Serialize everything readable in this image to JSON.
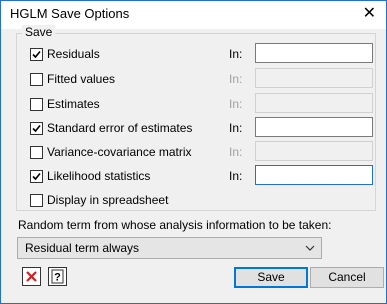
{
  "window": {
    "title": "HGLM Save Options"
  },
  "save_group": {
    "label": "Save",
    "in_label": "In:",
    "options": [
      {
        "label": "Residuals",
        "checked": true,
        "in_enabled": true,
        "focused": false
      },
      {
        "label": "Fitted values",
        "checked": false,
        "in_enabled": false,
        "focused": false
      },
      {
        "label": "Estimates",
        "checked": false,
        "in_enabled": false,
        "focused": false
      },
      {
        "label": "Standard error of estimates",
        "checked": true,
        "in_enabled": true,
        "focused": false
      },
      {
        "label": "Variance-covariance matrix",
        "checked": false,
        "in_enabled": false,
        "focused": false
      },
      {
        "label": "Likelihood statistics",
        "checked": true,
        "in_enabled": true,
        "focused": true
      },
      {
        "label": "Display in spreadsheet",
        "checked": false
      }
    ]
  },
  "random_term": {
    "label": "Random term from whose analysis information to be taken:",
    "selected": "Residual term always"
  },
  "footer": {
    "clear_icon": "red-x-icon",
    "help_icon": "question-icon",
    "save_label": "Save",
    "cancel_label": "Cancel"
  },
  "colors": {
    "accent": "#1f6fd6",
    "clear": "#d12020"
  }
}
